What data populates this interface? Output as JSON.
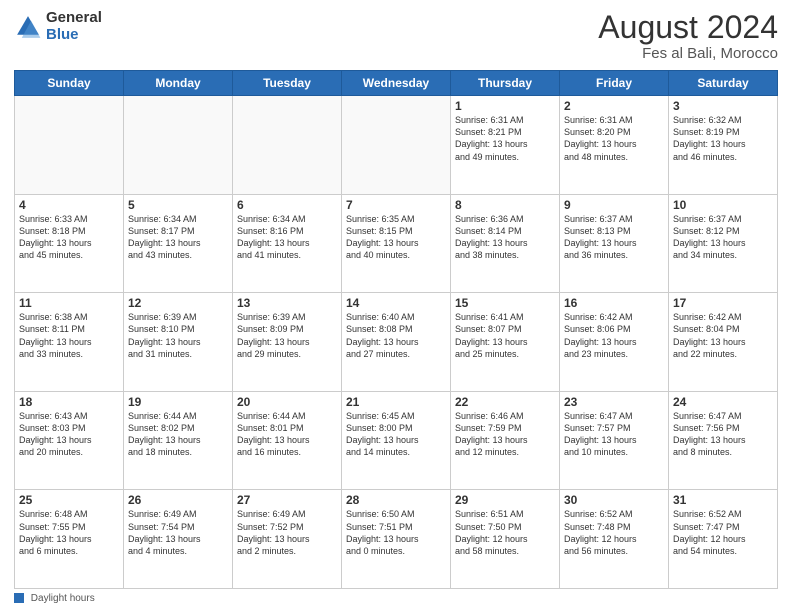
{
  "logo": {
    "general": "General",
    "blue": "Blue"
  },
  "header": {
    "month_year": "August 2024",
    "location": "Fes al Bali, Morocco"
  },
  "days_of_week": [
    "Sunday",
    "Monday",
    "Tuesday",
    "Wednesday",
    "Thursday",
    "Friday",
    "Saturday"
  ],
  "weeks": [
    [
      {
        "day": "",
        "info": ""
      },
      {
        "day": "",
        "info": ""
      },
      {
        "day": "",
        "info": ""
      },
      {
        "day": "",
        "info": ""
      },
      {
        "day": "1",
        "info": "Sunrise: 6:31 AM\nSunset: 8:21 PM\nDaylight: 13 hours\nand 49 minutes."
      },
      {
        "day": "2",
        "info": "Sunrise: 6:31 AM\nSunset: 8:20 PM\nDaylight: 13 hours\nand 48 minutes."
      },
      {
        "day": "3",
        "info": "Sunrise: 6:32 AM\nSunset: 8:19 PM\nDaylight: 13 hours\nand 46 minutes."
      }
    ],
    [
      {
        "day": "4",
        "info": "Sunrise: 6:33 AM\nSunset: 8:18 PM\nDaylight: 13 hours\nand 45 minutes."
      },
      {
        "day": "5",
        "info": "Sunrise: 6:34 AM\nSunset: 8:17 PM\nDaylight: 13 hours\nand 43 minutes."
      },
      {
        "day": "6",
        "info": "Sunrise: 6:34 AM\nSunset: 8:16 PM\nDaylight: 13 hours\nand 41 minutes."
      },
      {
        "day": "7",
        "info": "Sunrise: 6:35 AM\nSunset: 8:15 PM\nDaylight: 13 hours\nand 40 minutes."
      },
      {
        "day": "8",
        "info": "Sunrise: 6:36 AM\nSunset: 8:14 PM\nDaylight: 13 hours\nand 38 minutes."
      },
      {
        "day": "9",
        "info": "Sunrise: 6:37 AM\nSunset: 8:13 PM\nDaylight: 13 hours\nand 36 minutes."
      },
      {
        "day": "10",
        "info": "Sunrise: 6:37 AM\nSunset: 8:12 PM\nDaylight: 13 hours\nand 34 minutes."
      }
    ],
    [
      {
        "day": "11",
        "info": "Sunrise: 6:38 AM\nSunset: 8:11 PM\nDaylight: 13 hours\nand 33 minutes."
      },
      {
        "day": "12",
        "info": "Sunrise: 6:39 AM\nSunset: 8:10 PM\nDaylight: 13 hours\nand 31 minutes."
      },
      {
        "day": "13",
        "info": "Sunrise: 6:39 AM\nSunset: 8:09 PM\nDaylight: 13 hours\nand 29 minutes."
      },
      {
        "day": "14",
        "info": "Sunrise: 6:40 AM\nSunset: 8:08 PM\nDaylight: 13 hours\nand 27 minutes."
      },
      {
        "day": "15",
        "info": "Sunrise: 6:41 AM\nSunset: 8:07 PM\nDaylight: 13 hours\nand 25 minutes."
      },
      {
        "day": "16",
        "info": "Sunrise: 6:42 AM\nSunset: 8:06 PM\nDaylight: 13 hours\nand 23 minutes."
      },
      {
        "day": "17",
        "info": "Sunrise: 6:42 AM\nSunset: 8:04 PM\nDaylight: 13 hours\nand 22 minutes."
      }
    ],
    [
      {
        "day": "18",
        "info": "Sunrise: 6:43 AM\nSunset: 8:03 PM\nDaylight: 13 hours\nand 20 minutes."
      },
      {
        "day": "19",
        "info": "Sunrise: 6:44 AM\nSunset: 8:02 PM\nDaylight: 13 hours\nand 18 minutes."
      },
      {
        "day": "20",
        "info": "Sunrise: 6:44 AM\nSunset: 8:01 PM\nDaylight: 13 hours\nand 16 minutes."
      },
      {
        "day": "21",
        "info": "Sunrise: 6:45 AM\nSunset: 8:00 PM\nDaylight: 13 hours\nand 14 minutes."
      },
      {
        "day": "22",
        "info": "Sunrise: 6:46 AM\nSunset: 7:59 PM\nDaylight: 13 hours\nand 12 minutes."
      },
      {
        "day": "23",
        "info": "Sunrise: 6:47 AM\nSunset: 7:57 PM\nDaylight: 13 hours\nand 10 minutes."
      },
      {
        "day": "24",
        "info": "Sunrise: 6:47 AM\nSunset: 7:56 PM\nDaylight: 13 hours\nand 8 minutes."
      }
    ],
    [
      {
        "day": "25",
        "info": "Sunrise: 6:48 AM\nSunset: 7:55 PM\nDaylight: 13 hours\nand 6 minutes."
      },
      {
        "day": "26",
        "info": "Sunrise: 6:49 AM\nSunset: 7:54 PM\nDaylight: 13 hours\nand 4 minutes."
      },
      {
        "day": "27",
        "info": "Sunrise: 6:49 AM\nSunset: 7:52 PM\nDaylight: 13 hours\nand 2 minutes."
      },
      {
        "day": "28",
        "info": "Sunrise: 6:50 AM\nSunset: 7:51 PM\nDaylight: 13 hours\nand 0 minutes."
      },
      {
        "day": "29",
        "info": "Sunrise: 6:51 AM\nSunset: 7:50 PM\nDaylight: 12 hours\nand 58 minutes."
      },
      {
        "day": "30",
        "info": "Sunrise: 6:52 AM\nSunset: 7:48 PM\nDaylight: 12 hours\nand 56 minutes."
      },
      {
        "day": "31",
        "info": "Sunrise: 6:52 AM\nSunset: 7:47 PM\nDaylight: 12 hours\nand 54 minutes."
      }
    ]
  ],
  "legend": {
    "label": "Daylight hours"
  }
}
